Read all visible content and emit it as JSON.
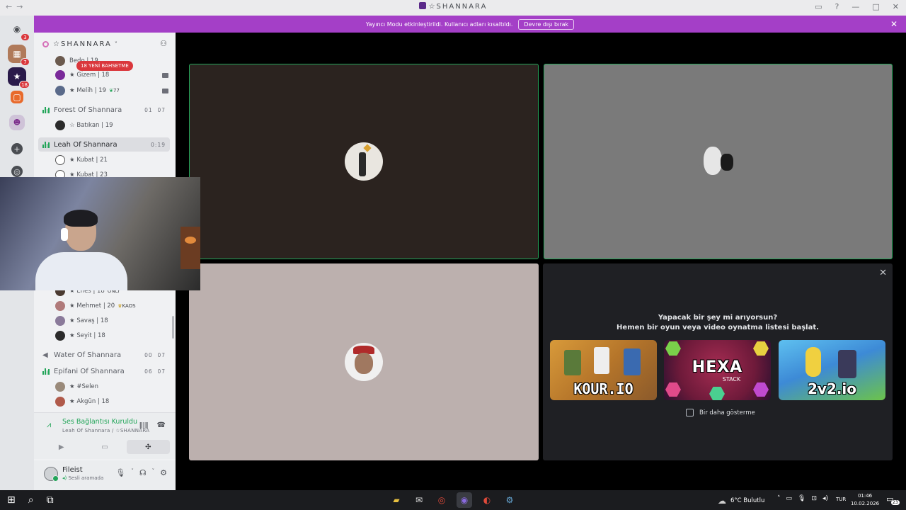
{
  "titlebar": {
    "title": "☆SHANNARA",
    "back": "←",
    "forward": "→"
  },
  "banner": {
    "text": "Yayıncı Modu etkinleştirildi. Kullanıcı adları kısaltıldı.",
    "button": "Devre dışı bırak"
  },
  "rail": {
    "badges": [
      "3",
      "7",
      "18"
    ]
  },
  "server": {
    "name": "☆SHANNARA"
  },
  "mention_pill": "18 YENİ BAHSETME",
  "channels": [
    {
      "name": "Forest Of Shannara",
      "count_left": "01",
      "count_right": "07"
    },
    {
      "name": "Leah Of Shannara",
      "timer": "0:19"
    },
    {
      "name": "Water Of Shannara",
      "count_left": "00",
      "count_right": "07"
    },
    {
      "name": "Epifani Of Shannara",
      "count_left": "06",
      "count_right": "07"
    }
  ],
  "users": {
    "top_partial": "Bedo | 19",
    "gizem": "★ Gizem | 18",
    "melih": "★ Melih | 19",
    "melih_tag": "77",
    "batikan": "☆ Batıkan | 19",
    "kubat21": "★ Kubat | 21",
    "kubat23": "★ Kubat | 23",
    "enes": "★ Enes | 18",
    "enes_tag": "ONLY",
    "mehmet": "★ Mehmet | 20",
    "mehmet_tag": "KAOS",
    "savas": "★ Savaş | 18",
    "seyit": "★ Seyit | 18",
    "selen": "★ #Selen",
    "akgun": "★ Akgün | 18"
  },
  "voice_panel": {
    "status": "Ses Bağlantısı Kuruldu",
    "sub": "Leah Of Shannara / ☆SHANNARA"
  },
  "user_panel": {
    "name": "Fileist",
    "status": "Sesli aramada"
  },
  "activity": {
    "title": "Yapacak bir şey mi arıyorsun?",
    "subtitle": "Hemen bir oyun veya video oynatma listesi başlat.",
    "games": [
      {
        "label": "KOUR.IO"
      },
      {
        "label": "HEXA",
        "sub": "STACK"
      },
      {
        "label": "2v2.io"
      }
    ],
    "checkbox": "Bir daha gösterme"
  },
  "taskbar": {
    "weather": "6°C  Bulutlu",
    "lang": "TUR",
    "time": "01:46",
    "date": "10.02.2026",
    "notif_count": "23"
  },
  "colors": {
    "accent_green": "#23a559",
    "banner": "#a43fc7",
    "mention": "#da373c"
  }
}
